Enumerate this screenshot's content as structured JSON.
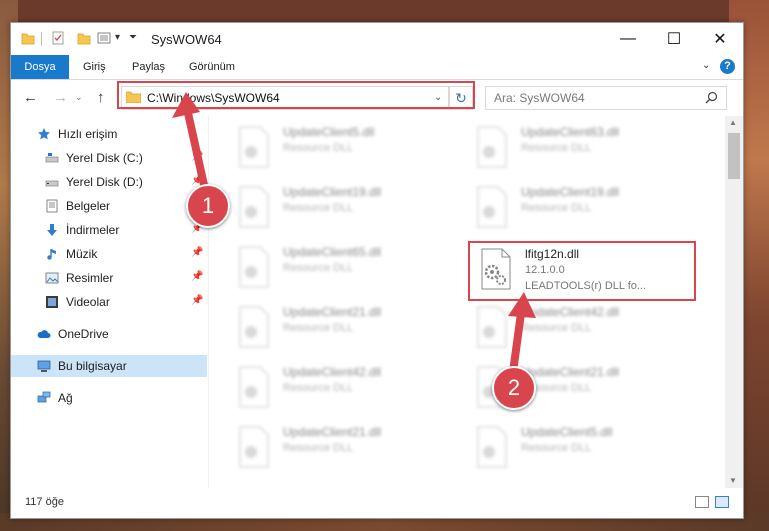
{
  "window": {
    "title": "SysWOW64",
    "minimize_glyph": "—",
    "maximize_glyph": "☐",
    "close_glyph": "✕"
  },
  "ribbon": {
    "tabs": [
      "Dosya",
      "Giriş",
      "Paylaş",
      "Görünüm"
    ],
    "help_glyph": "?"
  },
  "nav": {
    "address": "C:\\Windows\\SysWOW64",
    "search_placeholder": "Ara: SysWOW64"
  },
  "sidebar": {
    "items": [
      {
        "label": "Hızlı erişim",
        "icon": "star-icon"
      },
      {
        "label": "Yerel Disk (C:)",
        "icon": "drive-icon",
        "pinned": true
      },
      {
        "label": "Yerel Disk (D:)",
        "icon": "drive-icon",
        "pinned": true
      },
      {
        "label": "Belgeler",
        "icon": "documents-icon",
        "pinned": true
      },
      {
        "label": "İndirmeler",
        "icon": "download-icon",
        "pinned": true
      },
      {
        "label": "Müzik",
        "icon": "music-icon",
        "pinned": true
      },
      {
        "label": "Resimler",
        "icon": "pictures-icon",
        "pinned": true
      },
      {
        "label": "Videolar",
        "icon": "video-icon",
        "pinned": true
      },
      {
        "label": "OneDrive",
        "icon": "cloud-icon"
      },
      {
        "label": "Bu bilgisayar",
        "icon": "computer-icon",
        "selected": true
      },
      {
        "label": "Ağ",
        "icon": "network-icon"
      }
    ]
  },
  "files": {
    "left_column": [
      {
        "name": "UpdateClient5.dll",
        "type": "Resource DLL"
      },
      {
        "name": "UpdateClient19.dll",
        "type": "Resource DLL"
      },
      {
        "name": "UpdateClient65.dll",
        "type": "Resource DLL"
      },
      {
        "name": "UpdateClient21.dll",
        "type": "Resource DLL"
      },
      {
        "name": "UpdateClient42.dll",
        "type": "Resource DLL"
      },
      {
        "name": "UpdateClient21.dll",
        "type": "Resource DLL"
      }
    ],
    "right_column": [
      {
        "name": "UpdateClient63.dll",
        "type": "Resource DLL"
      },
      {
        "name": "UpdateClient19.dll",
        "type": "Resource DLL"
      },
      {
        "name": "UpdateClient42.dll",
        "type": "Resource DLL"
      },
      {
        "name": "UpdateClient21.dll",
        "type": "Resource DLL"
      },
      {
        "name": "UpdateClient5.dll",
        "type": "Resource DLL"
      }
    ],
    "highlighted": {
      "name": "lfitg12n.dll",
      "version": "12.1.0.0",
      "description": "LEADTOOLS(r) DLL fo..."
    }
  },
  "status": {
    "item_count": "117 öğe"
  },
  "callouts": [
    "1",
    "2"
  ],
  "colors": {
    "accent": "#1979ca",
    "highlight_red": "#d9454c",
    "selection": "#cce4f7"
  }
}
